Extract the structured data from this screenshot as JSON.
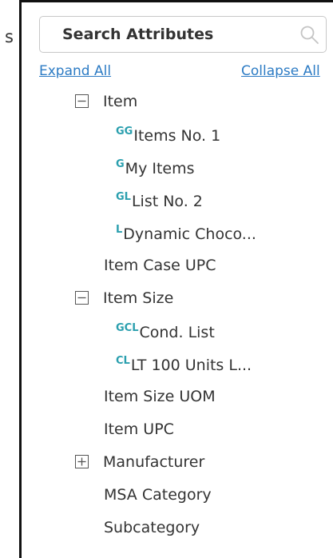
{
  "search": {
    "placeholder": "Search Attributes",
    "icon": "search-icon"
  },
  "actions": {
    "expand_all": "Expand All",
    "collapse_all": "Collapse All"
  },
  "colors": {
    "link": "#2c7bc4",
    "prefix": "#2a9fae",
    "text": "#333333",
    "border": "#111111"
  },
  "tree": [
    {
      "label": "Item",
      "toggle": "collapse",
      "children": [
        {
          "prefix": "GG",
          "label": "Items No. 1"
        },
        {
          "prefix": "G",
          "label": "My Items"
        },
        {
          "prefix": "GL",
          "label": "List No. 2"
        },
        {
          "prefix": "L",
          "label": "Dynamic Choco..."
        }
      ]
    },
    {
      "label": "Item Case UPC"
    },
    {
      "label": "Item Size",
      "toggle": "collapse",
      "children": [
        {
          "prefix": "GCL",
          "label": "Cond. List"
        },
        {
          "prefix": "CL",
          "label": "LT 100 Units L..."
        }
      ]
    },
    {
      "label": "Item Size UOM"
    },
    {
      "label": "Item UPC"
    },
    {
      "label": "Manufacturer",
      "toggle": "expand"
    },
    {
      "label": "MSA Category"
    },
    {
      "label": "Subcategory"
    }
  ]
}
